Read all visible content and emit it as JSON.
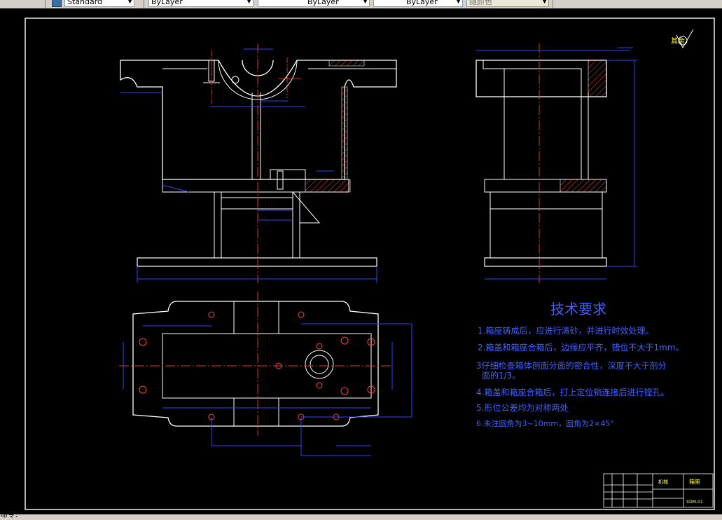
{
  "toolbar": {
    "text_style": "Standard",
    "layer": "ByLayer",
    "color": "ByLayer",
    "linetype": "ByLayer",
    "lineweight": "ByLayer",
    "plot_style": "随颜色"
  },
  "drawing": {
    "roughness_label": "其余",
    "tech_title": "技术要求",
    "tech_requirements": [
      "1.箱座铸成后，应进行清砂，并进行时效处理。",
      "2.箱盖和箱座合箱后，边缘应平齐，错位不大于1mm。",
      "3仔细检查箱体剖面分面的密合性，深度不大于剖分",
      "面的1/3。",
      "4.箱盖和箱座合箱后，打上定位销连接后进行镗孔。",
      "5.形位公差均为对称两处",
      "6.未注圆角为3~10mm，圆角为2×45°"
    ],
    "title_block": {
      "part_name": "箱座",
      "drawing_no": "XDM-01",
      "school": "机械"
    }
  },
  "status": {
    "text": "命令："
  }
}
